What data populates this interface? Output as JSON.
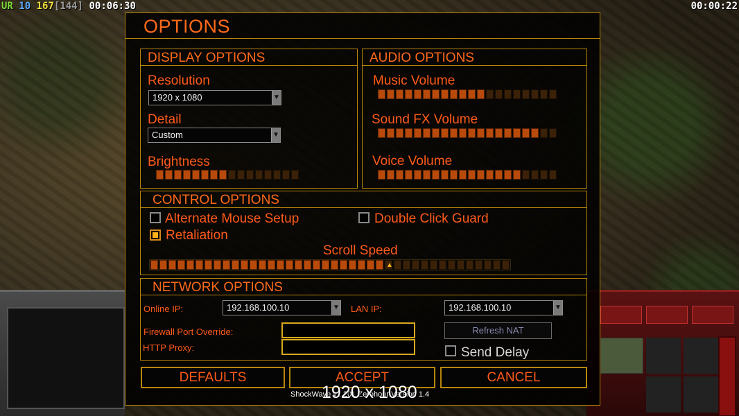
{
  "hud": {
    "stat_ur": "UR",
    "stat_10": "10",
    "stat_167": "167",
    "stat_144": "[144]",
    "elapsed_time": "00:06:30",
    "countdown": "00:00:22"
  },
  "options": {
    "title": "OPTIONS",
    "display": {
      "title": "DISPLAY OPTIONS",
      "resolution_label": "Resolution",
      "resolution_value": "1920 x 1080",
      "detail_label": "Detail",
      "detail_value": "Custom",
      "brightness_label": "Brightness",
      "brightness_level": 8,
      "brightness_max": 16
    },
    "audio": {
      "title": "AUDIO OPTIONS",
      "music_label": "Music Volume",
      "music_level": 12,
      "music_max": 20,
      "sfx_label": "Sound FX Volume",
      "sfx_level": 18,
      "sfx_max": 20,
      "voice_label": "Voice Volume",
      "voice_level": 16,
      "voice_max": 20
    },
    "control": {
      "title": "CONTROL OPTIONS",
      "alt_mouse_label": "Alternate Mouse Setup",
      "alt_mouse_checked": false,
      "double_click_label": "Double Click Guard",
      "double_click_checked": false,
      "retaliation_label": "Retaliation",
      "retaliation_checked": true,
      "scroll_speed_label": "Scroll Speed",
      "scroll_speed_level": 26,
      "scroll_speed_max": 40
    },
    "network": {
      "title": "NETWORK OPTIONS",
      "online_ip_label": "Online IP:",
      "online_ip_value": "192.168.100.10",
      "lan_ip_label": "LAN IP:",
      "lan_ip_value": "192.168.100.10",
      "firewall_label": "Firewall Port Override:",
      "firewall_value": "",
      "http_proxy_label": "HTTP Proxy:",
      "http_proxy_value": "",
      "refresh_nat_label": "Refresh NAT",
      "send_delay_label": "Send Delay",
      "send_delay_checked": false
    },
    "buttons": {
      "defaults": "DEFAULTS",
      "accept": "ACCEPT",
      "cancel": "CANCEL"
    }
  },
  "overlay_resolution": "1920 x 1080",
  "footer_version": "ShockWave v1.201 Zerohour Version 1.4",
  "colors": {
    "accent": "#ff5a1a",
    "border": "#b8860b",
    "slider_on": "#b84a0c",
    "slider_off": "#3a2108"
  }
}
